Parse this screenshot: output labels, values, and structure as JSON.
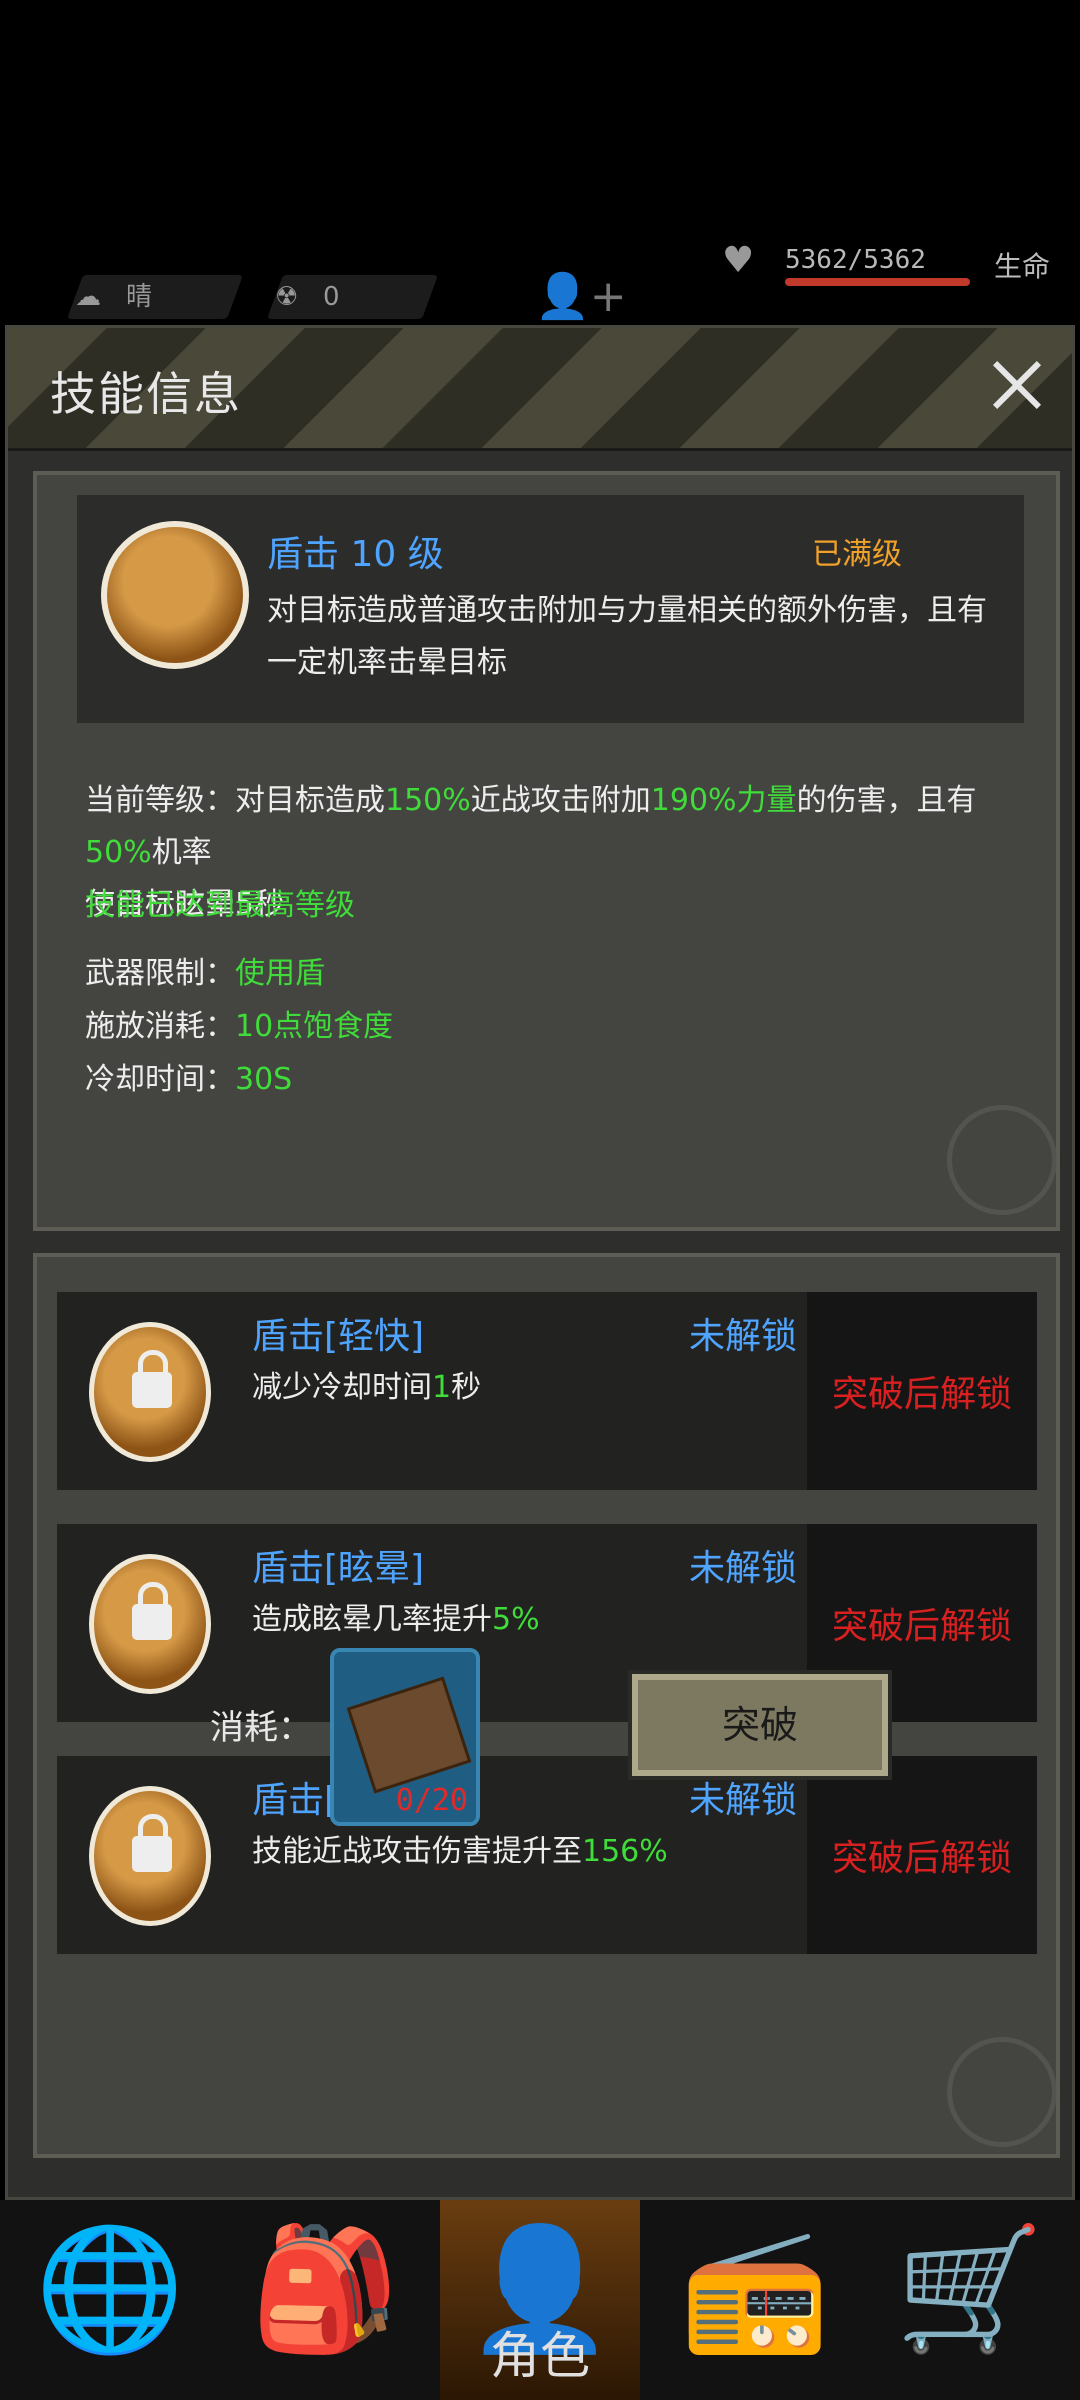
{
  "status": {
    "weather": "晴",
    "radiation": "0",
    "hp": "5362/5362",
    "hp_label": "生命"
  },
  "modal": {
    "title": "技能信息",
    "skill": {
      "name": "盾击 10 级",
      "status": "已满级",
      "description": "对目标造成普通攻击附加与力量相关的额外伤害，且有一定机率击晕目标"
    },
    "current_level": {
      "label": "当前等级：",
      "p1": "对目标造成",
      "v1": "150%",
      "p2": "近战攻击附加",
      "v2": "190%力量",
      "p3": "的伤害，且有",
      "v3": "50%",
      "p4": "机率",
      "line2": "使目标眩晕5秒"
    },
    "max_note": "技能已达到最高等级",
    "weapon": {
      "label": "武器限制：",
      "value": "使用盾"
    },
    "cost": {
      "label": "施放消耗：",
      "value": "10点饱食度"
    },
    "cooldown": {
      "label": "冷却时间：",
      "value": "30S"
    },
    "subskills": [
      {
        "name": "盾击[轻快]",
        "status": "未解锁",
        "desc_prefix": "减少冷却时间",
        "desc_value": "1",
        "desc_suffix": "秒",
        "lock": "突破后解锁"
      },
      {
        "name": "盾击[眩晕]",
        "status": "未解锁",
        "desc_prefix": "造成眩晕几率提升",
        "desc_value": "5%",
        "desc_suffix": "",
        "lock": "突破后解锁"
      },
      {
        "name": "盾击[强力]",
        "status": "未解锁",
        "desc_prefix": "技能近战攻击伤害提升至",
        "desc_value": "156%",
        "desc_suffix": "",
        "lock": "突破后解锁"
      }
    ],
    "consume_label": "消耗：",
    "consume_count": "0/20",
    "breakthrough": "突破"
  },
  "nav": {
    "active_label": "角色"
  }
}
